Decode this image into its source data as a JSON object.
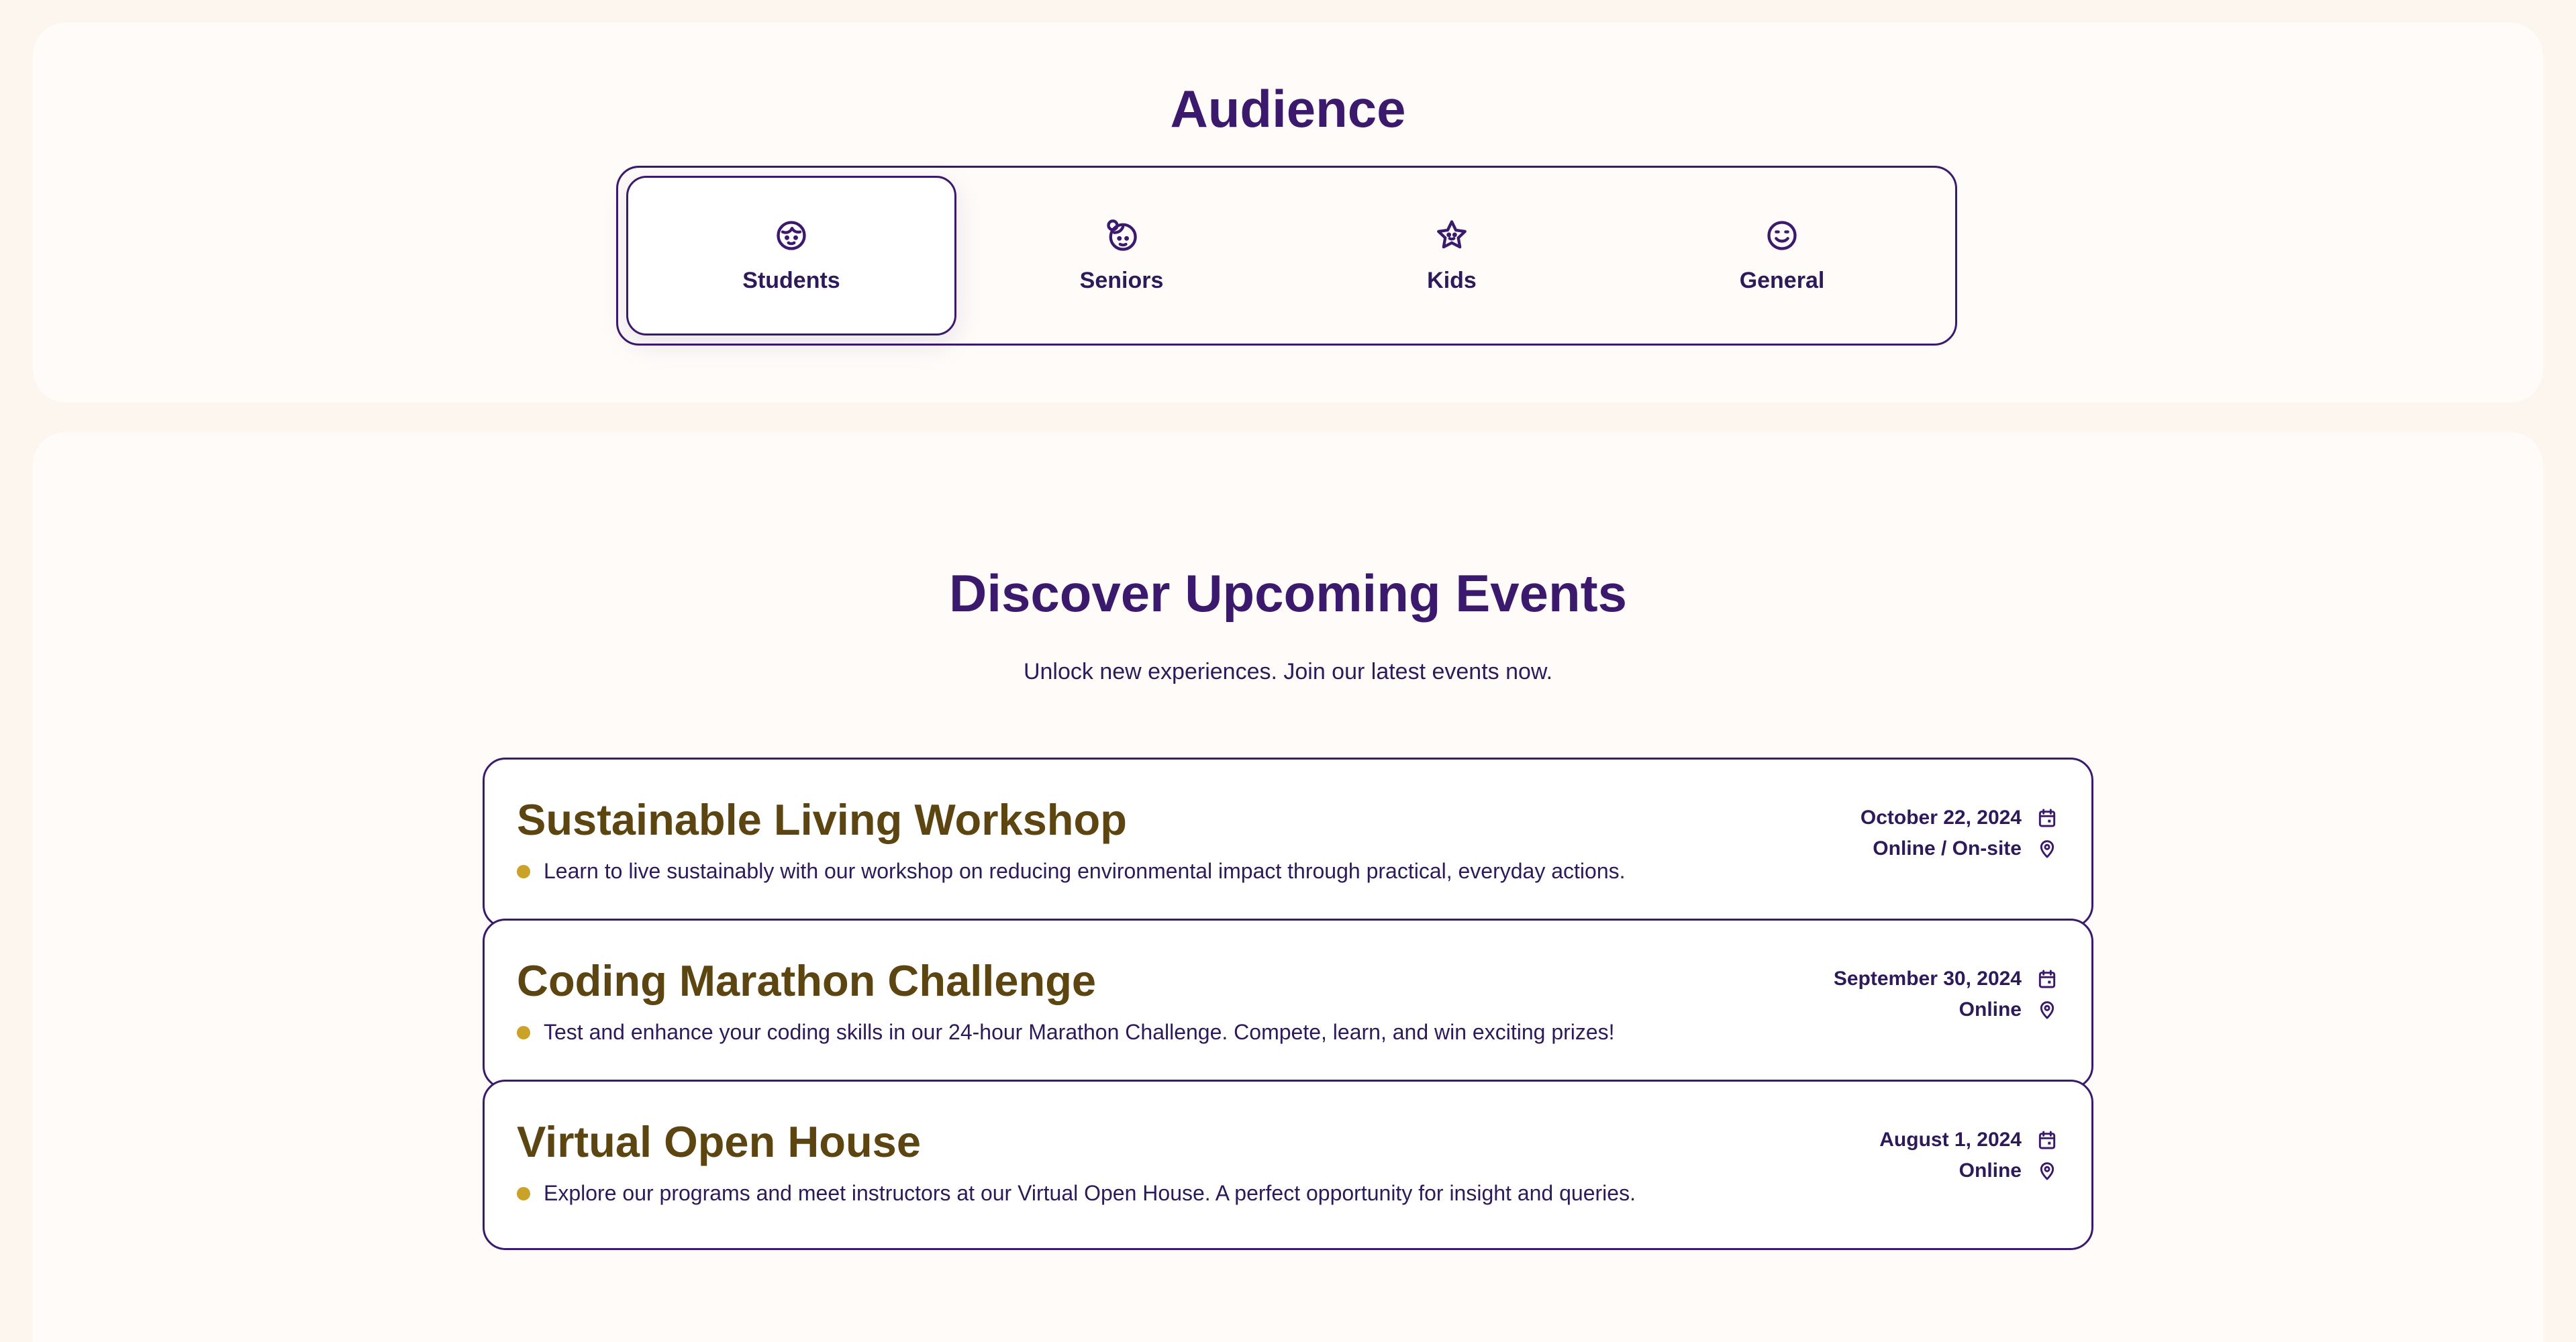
{
  "audience": {
    "title": "Audience",
    "tabs": [
      {
        "label": "Students",
        "icon": "student-face-icon",
        "active": true
      },
      {
        "label": "Seniors",
        "icon": "senior-face-icon",
        "active": false
      },
      {
        "label": "Kids",
        "icon": "star-face-icon",
        "active": false
      },
      {
        "label": "General",
        "icon": "smiley-face-icon",
        "active": false
      }
    ]
  },
  "events": {
    "title": "Discover Upcoming Events",
    "subtitle": "Unlock new experiences. Join our latest events now.",
    "items": [
      {
        "title": "Sustainable Living Workshop",
        "description": "Learn to live sustainably with our workshop on reducing environmental impact through practical, everyday actions.",
        "date": "October 22, 2024",
        "location": "Online / On-site"
      },
      {
        "title": "Coding Marathon Challenge",
        "description": "Test and enhance your coding skills in our 24-hour Marathon Challenge. Compete, learn, and win exciting prizes!",
        "date": "September 30, 2024",
        "location": "Online"
      },
      {
        "title": "Virtual Open House",
        "description": "Explore our programs and meet instructors at our Virtual Open House. A perfect opportunity for insight and queries.",
        "date": "August 1, 2024",
        "location": "Online"
      }
    ]
  },
  "colors": {
    "primary": "#3b1a6e",
    "title_gold": "#5c4510",
    "bullet": "#c9a227",
    "page_bg": "#fdf6ee",
    "panel_bg": "#fefbf9"
  }
}
